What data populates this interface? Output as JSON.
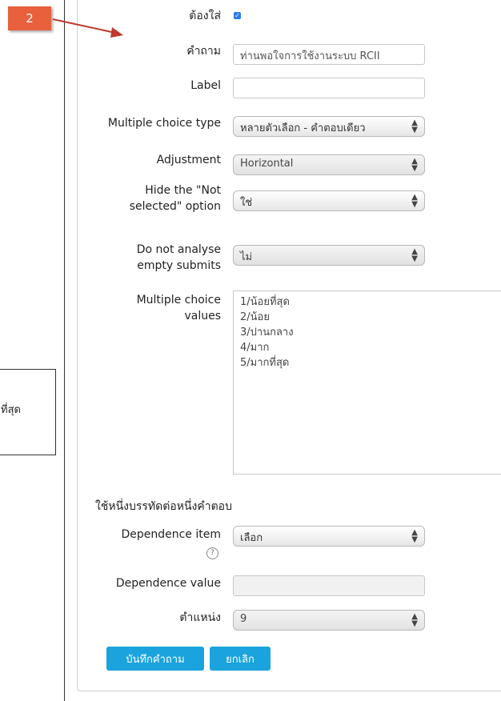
{
  "annotation": {
    "badge": "2",
    "callout_text": "ที่สุด"
  },
  "form": {
    "required": {
      "label": "ต้องใส่",
      "checked": true
    },
    "question": {
      "label": "คำถาม",
      "value": "ท่านพอใจการใช้งานระบบ RCII"
    },
    "label_field": {
      "label": "Label",
      "value": ""
    },
    "choice_type": {
      "label": "Multiple choice type",
      "value": "หลายตัวเลือก - คำตอบเดียว"
    },
    "adjustment": {
      "label": "Adjustment",
      "value": "Horizontal"
    },
    "hide_not_selected": {
      "label_line1": "Hide the \"Not",
      "label_line2": "selected\" option",
      "value": "ใช่"
    },
    "no_analyse_empty": {
      "label_line1": "Do not analyse",
      "label_line2": "empty submits",
      "value": "ไม่"
    },
    "choice_values": {
      "label_line1": "Multiple choice",
      "label_line2": "values",
      "items": [
        "1/น้อยที่สุด",
        "2/น้อย",
        "3/ปานกลาง",
        "4/มาก",
        "5/มากที่สุด"
      ]
    },
    "hint": "ใช้หนึ่งบรรทัดต่อหนึ่งคำตอบ",
    "dependence_item": {
      "label": "Dependence item",
      "value": "เลือก"
    },
    "dependence_value": {
      "label": "Dependence value",
      "value": ""
    },
    "position": {
      "label": "ตำแหน่ง",
      "value": "9"
    },
    "buttons": {
      "save": "บันทึกคำถาม",
      "cancel": "ยกเลิก"
    }
  }
}
